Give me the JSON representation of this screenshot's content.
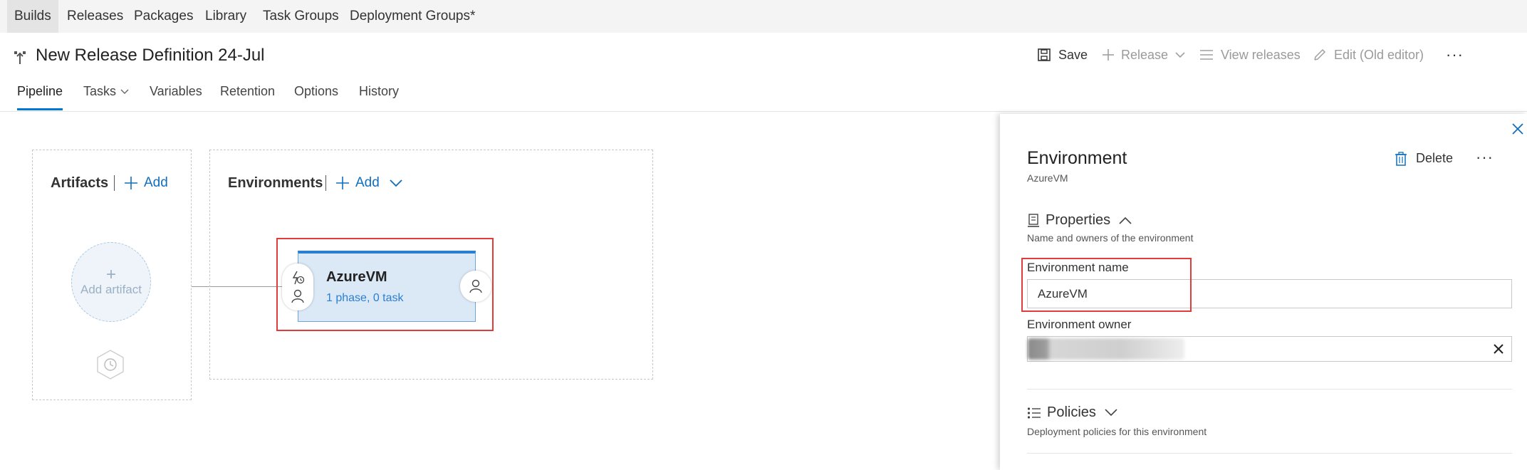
{
  "hub_tabs": [
    "Builds",
    "Releases",
    "Packages",
    "Library",
    "Task Groups",
    "Deployment Groups*"
  ],
  "definition": {
    "title": "New Release Definition 24-Jul"
  },
  "toolbar": {
    "save": "Save",
    "release": "Release",
    "view_releases": "View releases",
    "edit_old": "Edit (Old editor)",
    "more": "···"
  },
  "tabs": [
    "Pipeline",
    "Tasks",
    "Variables",
    "Retention",
    "Options",
    "History"
  ],
  "pipeline": {
    "artifacts_title": "Artifacts",
    "artifacts_add": "Add",
    "add_artifact": "Add artifact",
    "environments_title": "Environments",
    "environments_add": "Add",
    "environment_card": {
      "name": "AzureVM",
      "subtitle": "1 phase, 0 task"
    }
  },
  "panel": {
    "title": "Environment",
    "subtitle": "AzureVM",
    "delete": "Delete",
    "more": "···",
    "properties_title": "Properties",
    "properties_desc": "Name and owners of the environment",
    "env_name_label": "Environment name",
    "env_name_value": "AzureVM",
    "env_owner_label": "Environment owner",
    "policies_title": "Policies",
    "policies_desc": "Deployment policies for this environment"
  },
  "colors": {
    "accent": "#0078d4",
    "highlight": "#e03c3c",
    "card_fill": "#dbe8f6"
  }
}
